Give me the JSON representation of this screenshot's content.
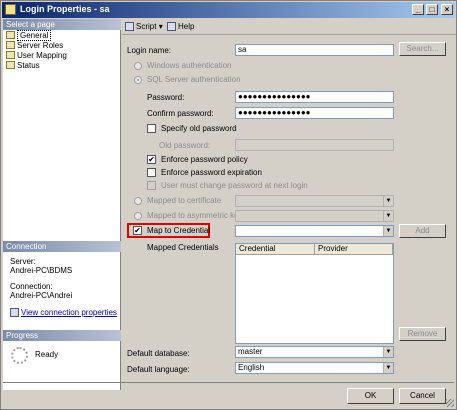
{
  "window": {
    "title": "Login Properties - sa",
    "min_label": "_",
    "max_label": "□",
    "close_label": "×"
  },
  "left": {
    "select_page_header": "Select a page",
    "pages": [
      {
        "label": "General",
        "selected": true
      },
      {
        "label": "Server Roles"
      },
      {
        "label": "User Mapping"
      },
      {
        "label": "Status"
      }
    ],
    "connection_header": "Connection",
    "server_label": "Server:",
    "server_value": "Andrei-PC\\BDMS",
    "connection_label": "Connection:",
    "connection_value": "Andrei-PC\\Andrei",
    "view_props_link": "View connection properties",
    "progress_header": "Progress",
    "progress_status": "Ready"
  },
  "toolbar": {
    "script_label": "Script",
    "script_arrow": "▾",
    "help_label": "Help"
  },
  "form": {
    "login_name_label": "Login name:",
    "login_name_value": "sa",
    "search_button": "Search...",
    "windows_auth": "Windows authentication",
    "sql_auth": "SQL Server authentication",
    "password_label": "Password:",
    "password_value": "●●●●●●●●●●●●●●●",
    "confirm_label": "Confirm password:",
    "confirm_value": "●●●●●●●●●●●●●●●",
    "specify_old_label": "Specify old password",
    "old_password_label": "Old password:",
    "enforce_policy_label": "Enforce password policy",
    "enforce_expiration_label": "Enforce password expiration",
    "must_change_label": "User must change password at next login",
    "mapped_cert_label": "Mapped to certificate",
    "mapped_key_label": "Mapped to asymmetric key",
    "map_credential_label": "Map to Credential",
    "add_button": "Add",
    "mapped_credentials_label": "Mapped Credentials",
    "grid_columns": [
      "Credential",
      "Provider"
    ],
    "remove_button": "Remove",
    "default_db_label": "Default database:",
    "default_db_value": "master",
    "default_lang_label": "Default language:",
    "default_lang_value": "English",
    "check_mark": "✔",
    "combo_arrow": "▼"
  },
  "footer": {
    "ok_button": "OK",
    "cancel_button": "Cancel"
  }
}
